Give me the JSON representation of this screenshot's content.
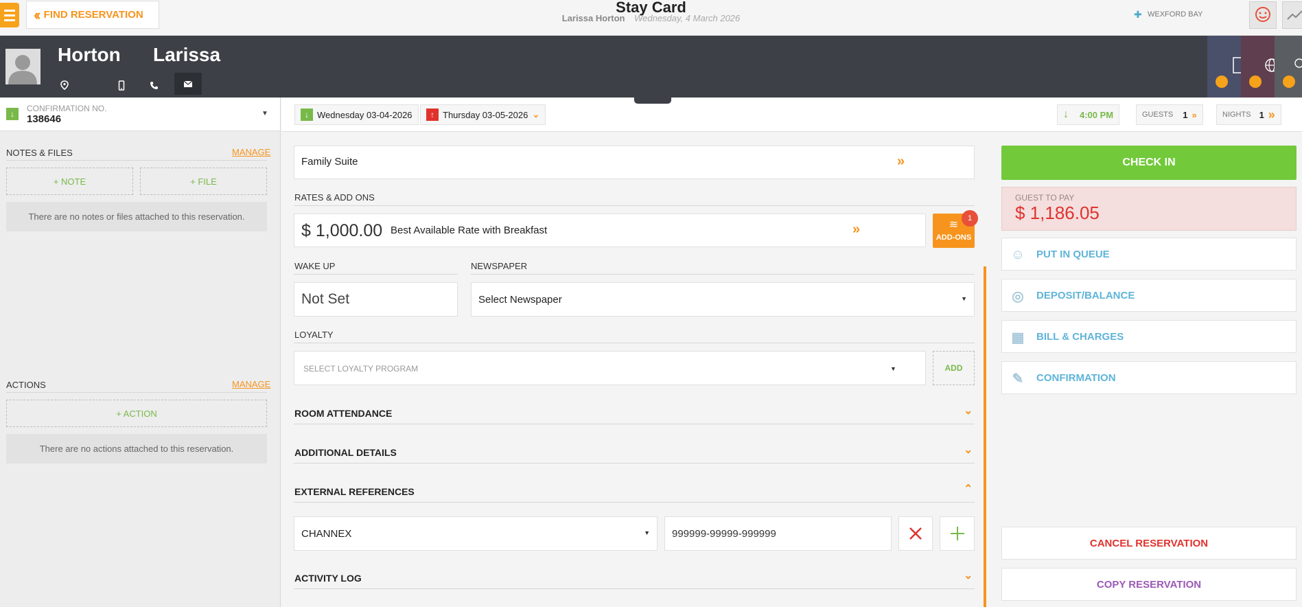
{
  "header": {
    "find_reservation": "FIND RESERVATION",
    "title": "Stay Card",
    "guest_name": "Larissa Horton",
    "date": "Wednesday, 4 March 2026",
    "hotel": "WEXFORD BAY"
  },
  "guest": {
    "last_name": "Horton",
    "first_name": "Larissa"
  },
  "confirmation": {
    "label": "CONFIRMATION NO.",
    "number": "138646"
  },
  "notes": {
    "title": "NOTES & FILES",
    "manage": "MANAGE",
    "add_note": "+ NOTE",
    "add_file": "+ FILE",
    "empty": "There are no notes or files attached to this reservation."
  },
  "actions": {
    "title": "ACTIONS",
    "manage": "MANAGE",
    "add_action": "+ ACTION",
    "empty": "There are no actions attached to this reservation."
  },
  "dates": {
    "arrival": "Wednesday 03-04-2026",
    "departure": "Thursday 03-05-2026",
    "time": "4:00 PM",
    "guests_label": "GUESTS",
    "guests": "1",
    "nights_label": "NIGHTS",
    "nights": "1"
  },
  "room": {
    "type": "Family Suite"
  },
  "rates": {
    "label": "RATES & ADD ONS",
    "amount": "$ 1,000.00",
    "name": "Best Available Rate with Breakfast",
    "addons_label": "ADD-ONS",
    "addons_count": "1"
  },
  "wakeup": {
    "label": "WAKE UP",
    "value": "Not Set"
  },
  "newspaper": {
    "label": "NEWSPAPER",
    "value": "Select Newspaper"
  },
  "loyalty": {
    "label": "LOYALTY",
    "placeholder": "SELECT LOYALTY PROGRAM",
    "add": "ADD"
  },
  "sections": {
    "room_attendance": "ROOM ATTENDANCE",
    "additional_details": "ADDITIONAL DETAILS",
    "external_references": "EXTERNAL REFERENCES",
    "activity_log": "ACTIVITY LOG"
  },
  "external_ref": {
    "channel": "CHANNEX",
    "reference": "999999-99999-999999"
  },
  "right": {
    "check_in": "CHECK IN",
    "guest_to_pay_label": "GUEST TO PAY",
    "guest_to_pay": "$ 1,186.05",
    "put_in_queue": "PUT IN QUEUE",
    "deposit_balance": "DEPOSIT/BALANCE",
    "bill_charges": "BILL & CHARGES",
    "confirmation": "CONFIRMATION",
    "cancel_reservation": "CANCEL RESERVATION",
    "copy_reservation": "COPY RESERVATION"
  },
  "colors": {
    "accent": "#f7941d",
    "green": "#72c93a",
    "red": "#e0332e",
    "blue": "#5fb4d8",
    "purple": "#9b59b6",
    "dark": "#3d4046"
  }
}
